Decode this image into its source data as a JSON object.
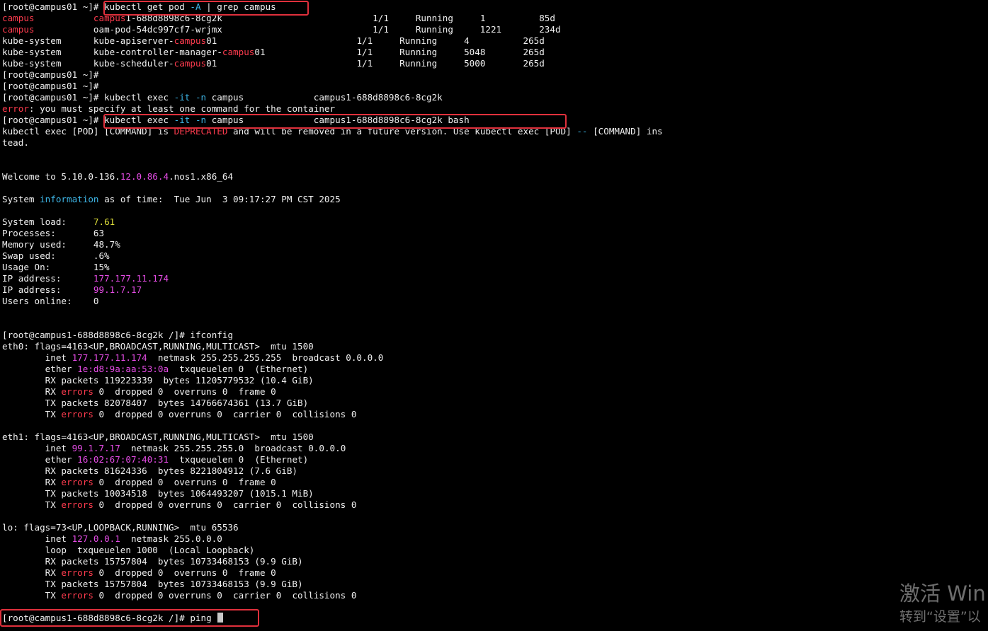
{
  "colors": {
    "background": "#000000",
    "text": "#f0f0f0",
    "red": "#ff3b4e",
    "cyan": "#3eb7e8",
    "magenta": "#e54ce5",
    "yellow": "#dede3a",
    "highlight_box": "#e0303c"
  },
  "terminal": {
    "lines": [
      [
        [
          "w",
          "[root@campus01 ~]# "
        ],
        [
          "w",
          "kubectl get pod "
        ],
        [
          "c",
          "-A"
        ],
        [
          "w",
          " | grep campus"
        ]
      ],
      [
        [
          "r",
          "campus"
        ],
        [
          "w",
          "           "
        ],
        [
          "r",
          "campus"
        ],
        [
          "w",
          "1-688d8898c6-8cg2k                            1/1     Running     1          85d"
        ]
      ],
      [
        [
          "r",
          "campus"
        ],
        [
          "w",
          "           oam-pod-54dc997cf7-wrjmx                            1/1     Running     1221       234d"
        ]
      ],
      [
        [
          "w",
          "kube-system      kube-apiserver-"
        ],
        [
          "r",
          "campus"
        ],
        [
          "w",
          "01                          1/1     Running     4          265d"
        ]
      ],
      [
        [
          "w",
          "kube-system      kube-controller-manager-"
        ],
        [
          "r",
          "campus"
        ],
        [
          "w",
          "01                 1/1     Running     5048       265d"
        ]
      ],
      [
        [
          "w",
          "kube-system      kube-scheduler-"
        ],
        [
          "r",
          "campus"
        ],
        [
          "w",
          "01                          1/1     Running     5000       265d"
        ]
      ],
      [
        [
          "w",
          "[root@campus01 ~]#"
        ]
      ],
      [
        [
          "w",
          "[root@campus01 ~]#"
        ]
      ],
      [
        [
          "w",
          "[root@campus01 ~]# kubectl exec "
        ],
        [
          "c",
          "-it -n"
        ],
        [
          "w",
          " campus             campus1-688d8898c6-8cg2k"
        ]
      ],
      [
        [
          "r",
          "error"
        ],
        [
          "w",
          ": you must specify at least one command for the container"
        ]
      ],
      [
        [
          "w",
          "[root@campus01 ~]# kubectl exec "
        ],
        [
          "c",
          "-it -n"
        ],
        [
          "w",
          " campus             campus1-688d8898c6-8cg2k bash"
        ]
      ],
      [
        [
          "w",
          "kubectl exec [POD] [COMMAND] is "
        ],
        [
          "r",
          "DEPRECATED"
        ],
        [
          "w",
          " and will be removed in a future version. Use kubectl exec [POD] "
        ],
        [
          "c",
          "--"
        ],
        [
          "w",
          " [COMMAND] ins"
        ]
      ],
      [
        [
          "w",
          "tead."
        ]
      ],
      [],
      [],
      [
        [
          "w",
          "Welcome to 5.10.0-136."
        ],
        [
          "m",
          "12.0.86.4"
        ],
        [
          "w",
          ".nos1.x86_64"
        ]
      ],
      [],
      [
        [
          "w",
          "System "
        ],
        [
          "c",
          "information"
        ],
        [
          "w",
          " as of time:  Tue Jun  3 09:17:27 PM CST 2025"
        ]
      ],
      [],
      [
        [
          "w",
          "System load:     "
        ],
        [
          "y",
          "7.61"
        ]
      ],
      [
        [
          "w",
          "Processes:       63"
        ]
      ],
      [
        [
          "w",
          "Memory used:     48.7%"
        ]
      ],
      [
        [
          "w",
          "Swap used:       .6%"
        ]
      ],
      [
        [
          "w",
          "Usage On:        15%"
        ]
      ],
      [
        [
          "w",
          "IP address:      "
        ],
        [
          "m",
          "177.177.11.174"
        ]
      ],
      [
        [
          "w",
          "IP address:      "
        ],
        [
          "m",
          "99.1.7.17"
        ]
      ],
      [
        [
          "w",
          "Users online:    0"
        ]
      ],
      [],
      [],
      [
        [
          "w",
          "[root@campus1-688d8898c6-8cg2k /]# ifconfig"
        ]
      ],
      [
        [
          "w",
          "eth0: flags=4163<UP,BROADCAST,RUNNING,MULTICAST>  mtu 1500"
        ]
      ],
      [
        [
          "w",
          "        inet "
        ],
        [
          "m",
          "177.177.11.174"
        ],
        [
          "w",
          "  netmask 255.255.255.255  broadcast 0.0.0.0"
        ]
      ],
      [
        [
          "w",
          "        ether "
        ],
        [
          "m",
          "1e:d8:9a:aa:53:0a"
        ],
        [
          "w",
          "  txqueuelen 0  (Ethernet)"
        ]
      ],
      [
        [
          "w",
          "        RX packets 119223339  bytes 11205779532 (10.4 GiB)"
        ]
      ],
      [
        [
          "w",
          "        RX "
        ],
        [
          "r",
          "errors"
        ],
        [
          "w",
          " 0  dropped 0  overruns 0  frame 0"
        ]
      ],
      [
        [
          "w",
          "        TX packets 82078407  bytes 14766674361 (13.7 GiB)"
        ]
      ],
      [
        [
          "w",
          "        TX "
        ],
        [
          "r",
          "errors"
        ],
        [
          "w",
          " 0  dropped 0 overruns 0  carrier 0  collisions 0"
        ]
      ],
      [],
      [
        [
          "w",
          "eth1: flags=4163<UP,BROADCAST,RUNNING,MULTICAST>  mtu 1500"
        ]
      ],
      [
        [
          "w",
          "        inet "
        ],
        [
          "m",
          "99.1.7.17"
        ],
        [
          "w",
          "  netmask 255.255.255.0  broadcast 0.0.0.0"
        ]
      ],
      [
        [
          "w",
          "        ether "
        ],
        [
          "m",
          "16:02:67:07:40:31"
        ],
        [
          "w",
          "  txqueuelen 0  (Ethernet)"
        ]
      ],
      [
        [
          "w",
          "        RX packets 81624336  bytes 8221804912 (7.6 GiB)"
        ]
      ],
      [
        [
          "w",
          "        RX "
        ],
        [
          "r",
          "errors"
        ],
        [
          "w",
          " 0  dropped 0  overruns 0  frame 0"
        ]
      ],
      [
        [
          "w",
          "        TX packets 10034518  bytes 1064493207 (1015.1 MiB)"
        ]
      ],
      [
        [
          "w",
          "        TX "
        ],
        [
          "r",
          "errors"
        ],
        [
          "w",
          " 0  dropped 0 overruns 0  carrier 0  collisions 0"
        ]
      ],
      [],
      [
        [
          "w",
          "lo: flags=73<UP,LOOPBACK,RUNNING>  mtu 65536"
        ]
      ],
      [
        [
          "w",
          "        inet "
        ],
        [
          "m",
          "127.0.0.1"
        ],
        [
          "w",
          "  netmask 255.0.0.0"
        ]
      ],
      [
        [
          "w",
          "        loop  txqueuelen 1000  (Local Loopback)"
        ]
      ],
      [
        [
          "w",
          "        RX packets 15757804  bytes 10733468153 (9.9 GiB)"
        ]
      ],
      [
        [
          "w",
          "        RX "
        ],
        [
          "r",
          "errors"
        ],
        [
          "w",
          " 0  dropped 0  overruns 0  frame 0"
        ]
      ],
      [
        [
          "w",
          "        TX packets 15757804  bytes 10733468153 (9.9 GiB)"
        ]
      ],
      [
        [
          "w",
          "        TX "
        ],
        [
          "r",
          "errors"
        ],
        [
          "w",
          " 0  dropped 0 overruns 0  carrier 0  collisions 0"
        ]
      ],
      [],
      [
        [
          "w",
          "[root@campus1-688d8898c6-8cg2k /]# ping "
        ]
      ]
    ]
  },
  "watermark": {
    "line1": "激活 Win",
    "line2": "转到“设置”以"
  }
}
